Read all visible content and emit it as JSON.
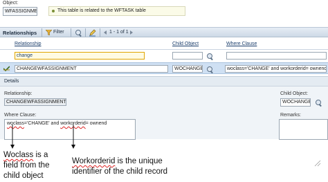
{
  "object": {
    "label": "Object:",
    "value": "WFASSIGNME",
    "note": "This table is related to the WFTASK table"
  },
  "toolbar": {
    "title": "Relationships",
    "filter_label": "Filter",
    "page_range": "1 - 1 of 1"
  },
  "columns": {
    "relationship": "Relationship",
    "child_object": "Child Object",
    "where_clause": "Where Clause"
  },
  "filter_row": {
    "relationship_value": "change"
  },
  "row": {
    "relationship": "CHANGEWFASSIGNMENT",
    "child_object": "WOCHANGE",
    "where_clause": "woclass='CHANGE' and workorderid= ownend"
  },
  "details": {
    "title": "Details",
    "relationship_label": "Relationship:",
    "relationship_value": "CHANGEWFASSIGNMENT",
    "child_object_label": "Child Object:",
    "child_object_value": "WOCHANGE",
    "where_clause_label": "Where Clause:",
    "where_prefix": "woclass",
    "where_mid": "='CHANGE' and ",
    "where_word": "workorderid",
    "where_suffix": "= ownend",
    "remarks_label": "Remarks:"
  },
  "annotations": {
    "woclass_word": "Woclass",
    "woclass_rest": " is a",
    "woclass_line2": "field from the",
    "woclass_line3": "child object",
    "workorderid_word": "Workorderid",
    "workorderid_rest": " is the unique",
    "workorderid_line2": "identifier of the child record"
  },
  "colors": {
    "toolbar_bg": "#d9e3ee",
    "selected_row_bg": "#cfe0f3",
    "details_bg": "#f0f4f8",
    "link_blue": "#1a3d6b",
    "annotation_underline": "#dd2222"
  }
}
